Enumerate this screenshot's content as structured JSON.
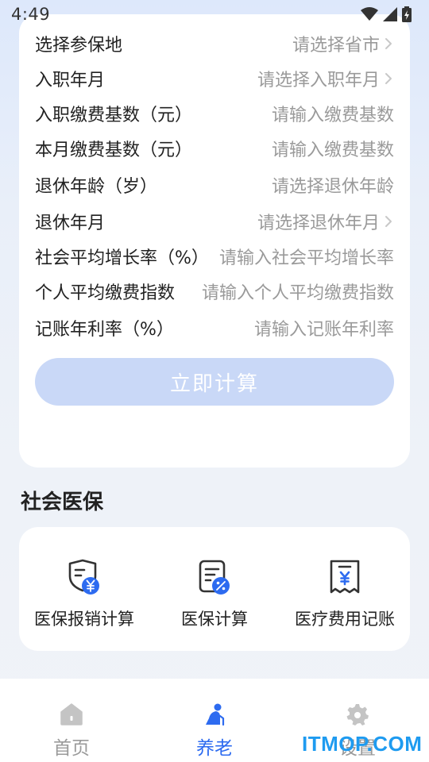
{
  "status_bar": {
    "time": "4:49"
  },
  "form": {
    "rows": [
      {
        "label": "选择参保地",
        "value": "请选择省市",
        "chevron": true
      },
      {
        "label": "入职年月",
        "value": "请选择入职年月",
        "chevron": true
      },
      {
        "label": "入职缴费基数（元）",
        "value": "请输入缴费基数",
        "chevron": false
      },
      {
        "label": "本月缴费基数（元）",
        "value": "请输入缴费基数",
        "chevron": false
      },
      {
        "label": "退休年龄（岁）",
        "value": "请选择退休年龄",
        "chevron": false
      },
      {
        "label": "退休年月",
        "value": "请选择退休年月",
        "chevron": true
      },
      {
        "label": "社会平均增长率（%）",
        "value": "请输入社会平均增长率",
        "chevron": false
      },
      {
        "label": "个人平均缴费指数",
        "value": "请输入个人平均缴费指数",
        "chevron": false
      },
      {
        "label": "记账年利率（%）",
        "value": "请输入记账年利率",
        "chevron": false
      }
    ],
    "submit_label": "立即计算"
  },
  "medical": {
    "section_title": "社会医保",
    "tools": [
      {
        "label": "医保报销计算",
        "icon": "shield-yuan-icon"
      },
      {
        "label": "医保计算",
        "icon": "document-percent-icon"
      },
      {
        "label": "医疗费用记账",
        "icon": "receipt-yuan-icon"
      }
    ]
  },
  "nav": {
    "items": [
      {
        "label": "首页",
        "icon": "home-icon",
        "active": false
      },
      {
        "label": "养老",
        "icon": "elder-person-icon",
        "active": true
      },
      {
        "label": "设置",
        "icon": "gear-icon",
        "active": false
      }
    ]
  },
  "watermark": "ITMOP.COM",
  "colors": {
    "accent": "#2d6bf0",
    "button_disabled": "#c9d8f7",
    "inactive": "#9a9a9a"
  }
}
